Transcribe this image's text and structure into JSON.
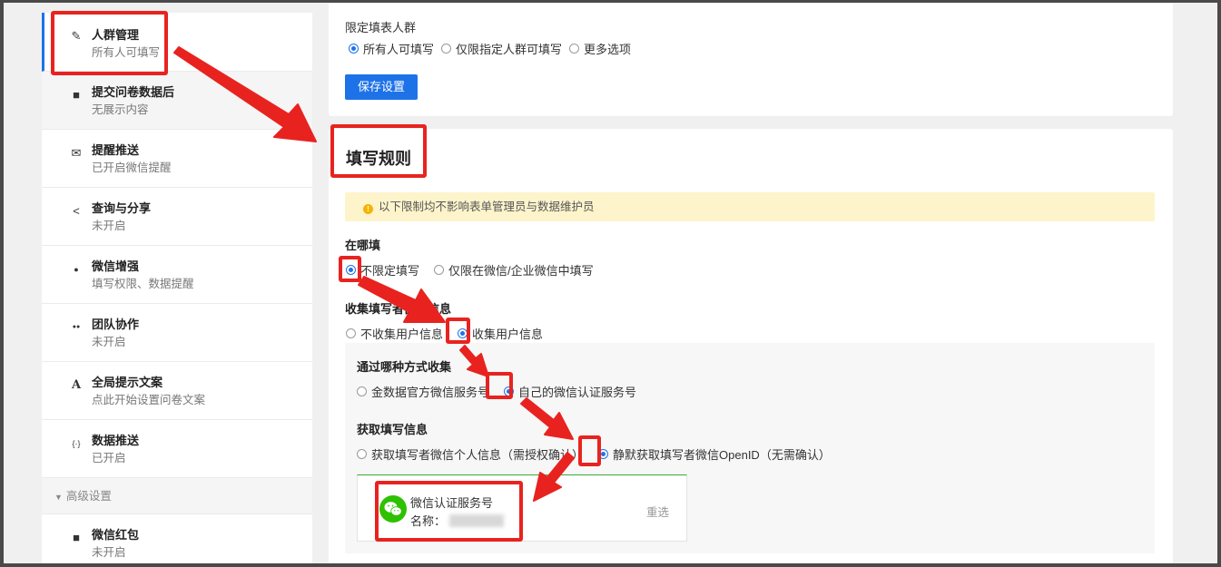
{
  "sidebar": {
    "items": [
      {
        "title": "人群管理",
        "sub": "所有人可填写",
        "icon": "pencil-icon",
        "glyph": "✎"
      },
      {
        "title": "提交问卷数据后",
        "sub": "无展示内容",
        "icon": "flag-icon",
        "glyph": "■"
      },
      {
        "title": "提醒推送",
        "sub": "已开启微信提醒",
        "icon": "mail-icon",
        "glyph": "✉"
      },
      {
        "title": "查询与分享",
        "sub": "未开启",
        "icon": "share-icon",
        "glyph": "<"
      },
      {
        "title": "微信增强",
        "sub": "填写权限、数据提醒",
        "icon": "wechat-icon",
        "glyph": "●"
      },
      {
        "title": "团队协作",
        "sub": "未开启",
        "icon": "team-icon",
        "glyph": "●●"
      },
      {
        "title": "全局提示文案",
        "sub": "点此开始设置问卷文案",
        "icon": "font-icon",
        "glyph": "A"
      },
      {
        "title": "数据推送",
        "sub": "已开启",
        "icon": "code-icon",
        "glyph": "{·}"
      }
    ],
    "section": "高级设置",
    "advanced_items": [
      {
        "title": "微信红包",
        "sub": "未开启",
        "icon": "redpacket-icon",
        "glyph": "■"
      }
    ]
  },
  "crowd": {
    "label": "限定填表人群",
    "options": [
      "所有人可填写",
      "仅限指定人群可填写",
      "更多选项"
    ],
    "selected": 0,
    "save_label": "保存设置"
  },
  "rules": {
    "title": "填写规则",
    "notice": "以下限制均不影响表单管理员与数据维护员",
    "where": {
      "label": "在哪填",
      "options": [
        "不限定填写",
        "仅限在微信/企业微信中填写"
      ],
      "selected": 0
    },
    "collect": {
      "label": "收集填写者微信信息",
      "options": [
        "不收集用户信息",
        "收集用户信息"
      ],
      "selected": 1
    },
    "method": {
      "label": "通过哪种方式收集",
      "options": [
        "金数据官方微信服务号",
        "自己的微信认证服务号"
      ],
      "selected": 1
    },
    "fetch": {
      "label": "获取填写信息",
      "options": [
        "获取填写者微信个人信息（需授权确认）",
        "静默获取填写者微信OpenID（无需确认）"
      ],
      "selected": 1
    },
    "account": {
      "title": "微信认证服务号",
      "name_label": "名称：",
      "reselect": "重选"
    }
  },
  "colors": {
    "accent": "#1e72e8",
    "annotation": "#e8231f",
    "notice_bg": "#fdf4cc",
    "wechat": "#2dc100"
  }
}
